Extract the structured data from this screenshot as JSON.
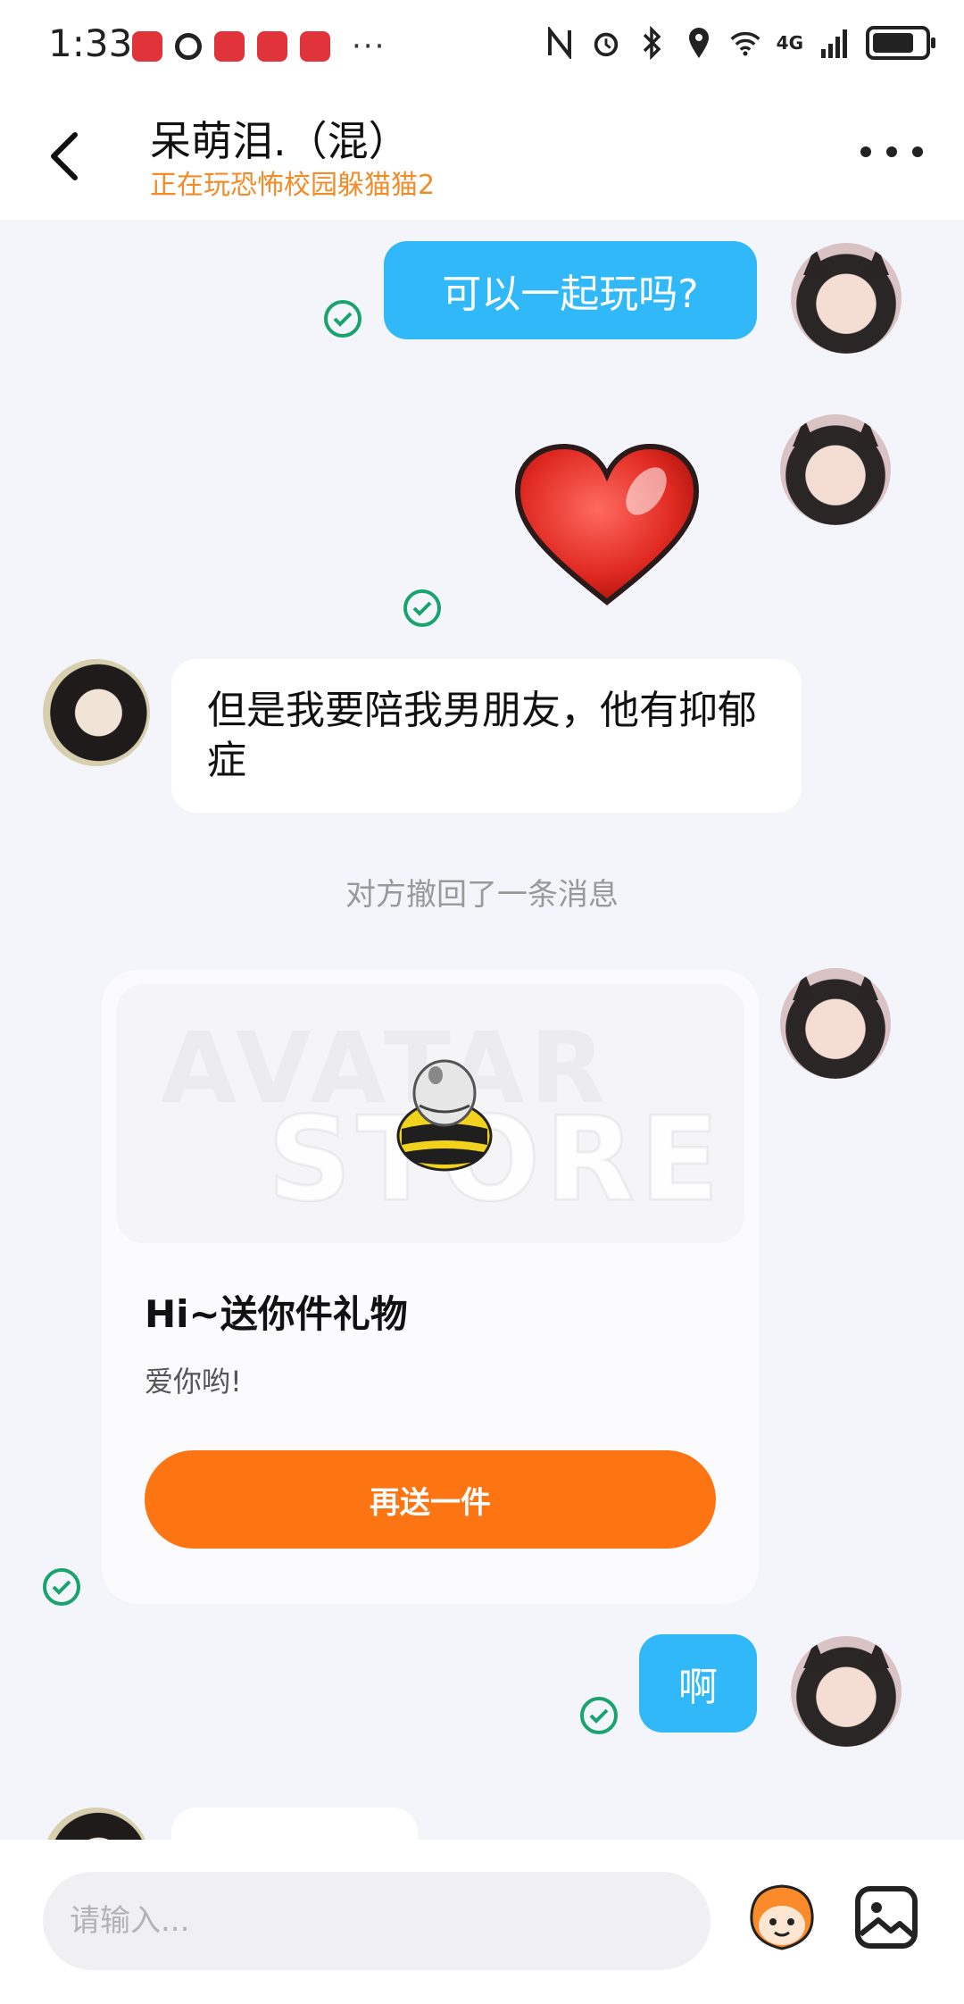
{
  "status_bar": {
    "time": "1:33",
    "more": "···",
    "network": "4G"
  },
  "header": {
    "title": "呆萌泪.（混）",
    "subtitle": "正在玩恐怖校园躲猫猫2"
  },
  "messages": {
    "m1_text": "可以一起玩吗?",
    "m3_text": "但是我要陪我男朋友，他有抑郁症",
    "recall_notice": "对方撤回了一条消息",
    "gift_title": "Hi~送你件礼物",
    "gift_message": "爱你哟!",
    "gift_button": "再送一件",
    "gift_watermark_1": "AVATAR",
    "gift_watermark_2": "STORE",
    "m5_text": "啊"
  },
  "input": {
    "placeholder": "请输入..."
  },
  "colors": {
    "bubble_me": "#30b8f8",
    "gift_button": "#fd7412",
    "subtitle": "#f28c28",
    "read_check": "#1aa36f"
  }
}
